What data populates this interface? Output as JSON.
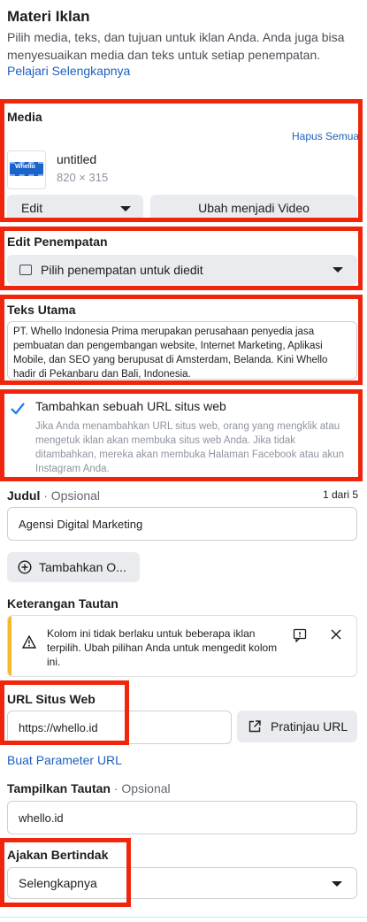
{
  "header": {
    "title": "Materi Iklan",
    "description": "Pilih media, teks, dan tujuan untuk iklan Anda. Anda juga bisa menyesuaikan media dan teks untuk setiap penempatan.",
    "learn_more": "Pelajari Selengkapnya"
  },
  "media": {
    "label": "Media",
    "remove_all": "Hapus Semua",
    "file_name": "untitled",
    "file_size": "820 × 315",
    "thumb_text": "Whello",
    "edit_label": "Edit",
    "convert_label": "Ubah menjadi Video"
  },
  "placement": {
    "label": "Edit Penempatan",
    "select_value": "Pilih penempatan untuk diedit"
  },
  "primary_text": {
    "label": "Teks Utama",
    "value": "PT. Whello Indonesia Prima merupakan perusahaan penyedia jasa pembuatan dan pengembangan website, Internet Marketing, Aplikasi Mobile, dan SEO yang berupusat di Amsterdam, Belanda. Kini Whello hadir di Pekanbaru dan Bali, Indonesia."
  },
  "website_option": {
    "label": "Tambahkan sebuah URL situs web",
    "description": "Jika Anda menambahkan URL situs web, orang yang mengklik atau mengetuk iklan akan membuka situs web Anda. Jika tidak ditambahkan, mereka akan membuka Halaman Facebook atau akun Instagram Anda."
  },
  "headline": {
    "label": "Judul",
    "optional": " · Opsional",
    "counter": "1 dari 5",
    "value": "Agensi Digital Marketing",
    "add_option": "Tambahkan O..."
  },
  "link_description": {
    "label": "Keterangan Tautan",
    "warning": "Kolom ini tidak berlaku untuk beberapa iklan terpilih. Ubah pilihan Anda untuk mengedit kolom ini."
  },
  "website_url": {
    "label": "URL Situs Web",
    "value": "https://whello.id",
    "preview": "Pratinjau URL",
    "build_params": "Buat Parameter URL"
  },
  "display_link": {
    "label": "Tampilkan Tautan",
    "optional": " · Opsional",
    "value": "whello.id"
  },
  "cta": {
    "label": "Ajakan Bertindak",
    "value": "Selengkapnya"
  },
  "colors": {
    "highlight": "#f0250b",
    "link": "#1d5fbf",
    "check": "#1877f2",
    "warning": "#f7b928"
  }
}
